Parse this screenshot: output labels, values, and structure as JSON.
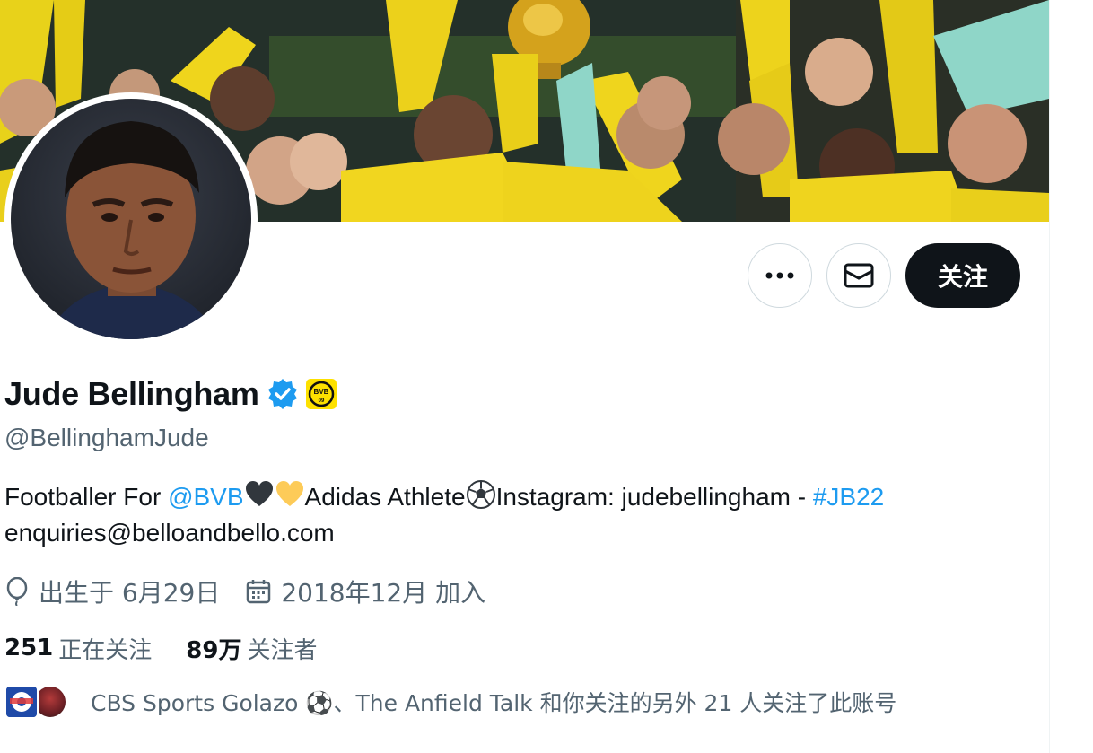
{
  "profile": {
    "display_name": "Jude Bellingham",
    "handle": "@BellinghamJude",
    "bio": {
      "text1": "Footballer For ",
      "mention": "@BVB",
      "text2": "Adidas Athlete",
      "text3": "Instagram: judebellingham - ",
      "hashtag": "#JB22",
      "line2": "enquiries@belloandbello.com"
    },
    "birthday": "出生于 6月29日",
    "joined": "2018年12月 加入",
    "following_count": "251",
    "following_label": "正在关注",
    "followers_count": "89万",
    "followers_label": "关注者",
    "followed_by": "CBS Sports Golazo ⚽️、The Anfield Talk 和你关注的另外 21 人关注了此账号",
    "club_badge_text": "BVB 09"
  },
  "actions": {
    "more_label": "•••",
    "follow_label": "关注"
  },
  "icons": {
    "verified": "verified-badge-icon",
    "club": "bvb-badge-icon",
    "more": "more-icon",
    "message": "envelope-icon",
    "birthday": "balloon-icon",
    "joined": "calendar-icon"
  },
  "colors": {
    "accent": "#1d9bf0",
    "text_primary": "#0f1419",
    "text_secondary": "#536471",
    "border": "#cfd9de",
    "bvb_yellow": "#fde100"
  }
}
